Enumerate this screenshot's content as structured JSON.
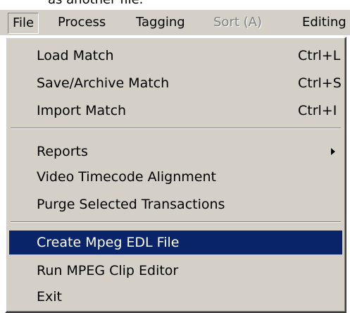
{
  "background_text": "as another file.",
  "menubar": {
    "items": [
      {
        "label": "File"
      },
      {
        "label": "Process"
      },
      {
        "label": "Tagging"
      },
      {
        "label": "Sort (A)"
      },
      {
        "label": "Editing"
      }
    ]
  },
  "file_menu": {
    "items": [
      {
        "label": "Load Match",
        "shortcut": "Ctrl+L"
      },
      {
        "label": "Save/Archive Match",
        "shortcut": "Ctrl+S"
      },
      {
        "label": "Import Match",
        "shortcut": "Ctrl+I"
      },
      {
        "label": "Reports"
      },
      {
        "label": "Video Timecode Alignment"
      },
      {
        "label": "Purge Selected Transactions"
      },
      {
        "label": "Create Mpeg EDL File"
      },
      {
        "label": "Run MPEG Clip Editor"
      },
      {
        "label": "Exit"
      }
    ]
  },
  "colors": {
    "menu_face": "#d4d0c8",
    "highlight": "#0a246a",
    "disabled_text": "#808080"
  }
}
